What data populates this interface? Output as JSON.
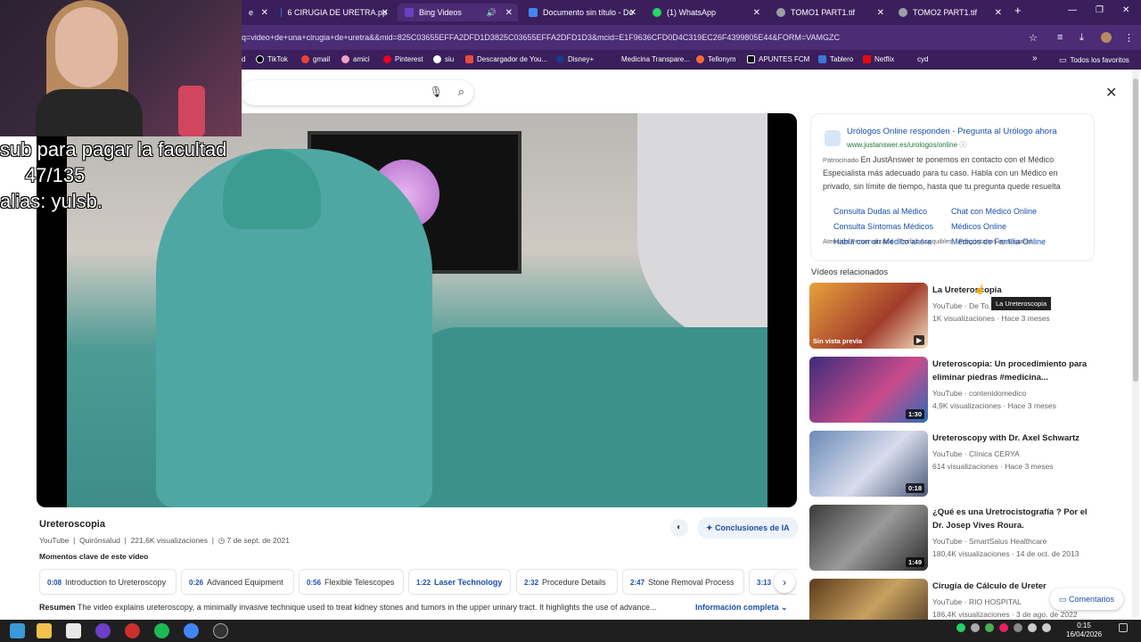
{
  "browser": {
    "tabs": [
      {
        "label": "e",
        "icon_color": "#ffffff"
      },
      {
        "label": "6 CIRUGIA DE URETRA.pp",
        "icon_color": "#2f6fd6"
      },
      {
        "label": "Bing Videos",
        "icon_color": "#6c3fc7"
      },
      {
        "label": "Documento sin título - Do",
        "icon_color": "#4285f4"
      },
      {
        "label": "(1) WhatsApp",
        "icon_color": "#25d366"
      },
      {
        "label": "TOMO1 PART1.tif",
        "icon_color": "#9aa0a6"
      },
      {
        "label": "TOMO2 PART1.tif",
        "icon_color": "#9aa0a6"
      }
    ],
    "url": "q=video+de+una+cirugia+de+uretra&&mid=825C03655EFFA2DFD1D3825C03655EFFA2DFD1D3&mcid=E1F9636CFD0D4C319EC26F4399805E44&FORM=VAMGZC",
    "bookmarks": [
      {
        "label": "d",
        "color": "#888888"
      },
      {
        "label": "TikTok",
        "color": "#000000"
      },
      {
        "label": "gmail",
        "color": "#ea4335"
      },
      {
        "label": "amici",
        "color": "#f4a3c4"
      },
      {
        "label": "Pinterest",
        "color": "#e60023"
      },
      {
        "label": "siu",
        "color": "#ffffff"
      },
      {
        "label": "Descargador de You...",
        "color": "#e84c3d"
      },
      {
        "label": "Disney+",
        "color": "#1a3a8a"
      },
      {
        "label": "Medicina Transpare...",
        "color": "#3a1f5c"
      },
      {
        "label": "Tellonym",
        "color": "#ff6a3d"
      },
      {
        "label": "APUNTES FCM",
        "color": "#111111"
      },
      {
        "label": "Tablero",
        "color": "#3c78d8"
      },
      {
        "label": "Netflix",
        "color": "#e50914"
      },
      {
        "label": "cyd",
        "color": "#3a1f5c"
      }
    ],
    "bookmarks_all": "Todos los favoritos"
  },
  "overlay": {
    "line1": "sub para pagar la facultad",
    "line2": "47/135",
    "line3": "alias: yulsb."
  },
  "video": {
    "title": "Ureteroscopia",
    "source": "YouTube",
    "channel": "Quirónsalud",
    "views": "221,6K visualizaciones",
    "date": "7 de sept. de 2021",
    "ai_button": "Conclusiones de IA",
    "key_moments_label": "Momentos clave de este vídeo",
    "chapters": [
      {
        "time": "0:08",
        "label": "Introduction to Ureteroscopy"
      },
      {
        "time": "0:26",
        "label": "Advanced Equipment"
      },
      {
        "time": "0:56",
        "label": "Flexible Telescopes"
      },
      {
        "time": "1:22",
        "label": "Laser Technology"
      },
      {
        "time": "2:32",
        "label": "Procedure Details"
      },
      {
        "time": "2:47",
        "label": "Stone Removal Process"
      },
      {
        "time": "3:13",
        "label": ""
      }
    ],
    "summary_label": "Resumen",
    "summary_text": "The video explains ureteroscopy, a minimally invasive technique used to treat kidney stones and tumors in the upper urinary tract. It highlights the use of advance...",
    "more_info": "Información completa"
  },
  "ad": {
    "title": "Urólogos Online responden - Pregunta al Urólogo ahora",
    "url": "www.justanswer.es/urologos/online",
    "sponsored": "Patrocinado",
    "description": "En JustAnswer te ponemos en contacto con el Médico Especialista más adecuado para tu caso. Habla con un Médico en privado, sin límite de tiempo, hasta que tu pregunta quede resuelta",
    "features": "Atención Personalizada · Tarifas Asequibles · Pregúntanos en Español",
    "links": [
      "Consulta Dudas al Médico",
      "Chat con Médico Online",
      "Consulta Síntomas Médicos",
      "Médicos Online",
      "Habla con un Médico ahora",
      "Médicos de Familia Online"
    ]
  },
  "related": {
    "header": "Vídeos relacionados",
    "items": [
      {
        "title": "La Ureteroscopia",
        "source": "YouTube · De To...",
        "views": "1K visualizaciones · Hace 3 meses",
        "duration": "",
        "preview": "Sin vista previa",
        "thumb_color": "#c97a3c"
      },
      {
        "title": "Ureteroscopia: Un procedimiento para eliminar piedras #medicina...",
        "source": "YouTube · contenidomedico",
        "views": "4,9K visualizaciones · Hace 3 meses",
        "duration": "1:30",
        "preview": "",
        "thumb_color": "#4a3a8a"
      },
      {
        "title": "Ureteroscopy with Dr. Axel Schwartz",
        "source": "YouTube · Clínica CERYA",
        "views": "614 visualizaciones · Hace 3 meses",
        "duration": "0:18",
        "preview": "",
        "thumb_color": "#6a8ab8"
      },
      {
        "title": "¿Qué es una Uretrocistografía ? Por el Dr. Josep Vives Roura.",
        "source": "YouTube · SmartSalus Healthcare",
        "views": "180,4K visualizaciones · 14 de oct. de 2013",
        "duration": "1:49",
        "preview": "",
        "thumb_color": "#5a5a5a"
      },
      {
        "title": "Cirugía de Cálculo de Ureter",
        "source": "YouTube · RIO HOSPITAL",
        "views": "186,4K visualizaciones · 3 de ago. de 2022",
        "duration": "",
        "preview": "",
        "thumb_color": "#8a6a3a"
      }
    ],
    "tooltip": "La Ureteroscopia"
  },
  "comments": "Comentarios",
  "taskbar": {
    "time": "0:15",
    "date": "16/04/2026"
  }
}
